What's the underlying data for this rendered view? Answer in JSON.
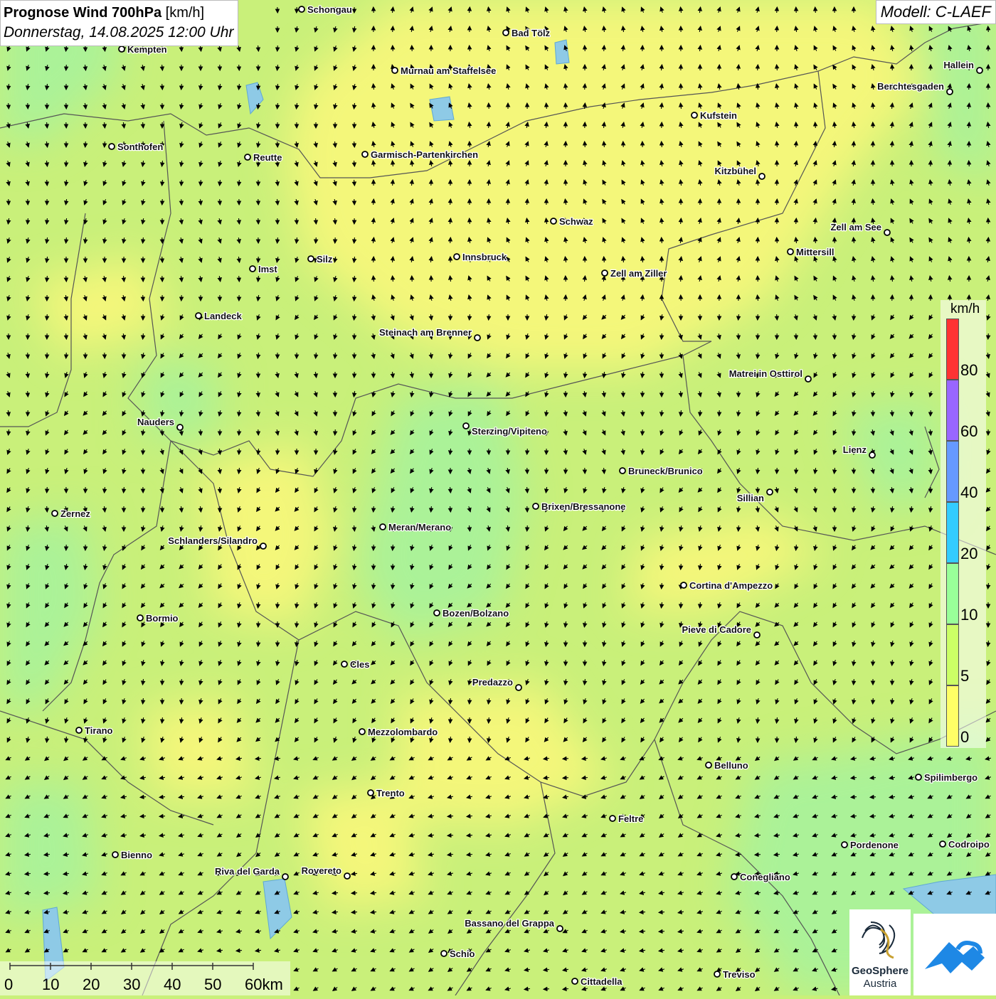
{
  "header": {
    "title_bold": "Prognose Wind 700hPa",
    "title_unit": " [km/h]",
    "datetime": "Donnerstag, 14.08.2025 12:00 Uhr"
  },
  "model": {
    "label": "Modell: C-LAEF"
  },
  "legend": {
    "unit": "km/h",
    "bins": [
      {
        "label": "0",
        "color": "#ffff66"
      },
      {
        "label": "5",
        "color": "#ccff66"
      },
      {
        "label": "10",
        "color": "#99ff99"
      },
      {
        "label": "20",
        "color": "#33ccff"
      },
      {
        "label": "40",
        "color": "#6699ff"
      },
      {
        "label": "60",
        "color": "#9966ff"
      },
      {
        "label": "80",
        "color": "#ff3333"
      }
    ]
  },
  "scalebar": {
    "labels": [
      "0",
      "10",
      "20",
      "30",
      "40",
      "50",
      "60km"
    ]
  },
  "logo": {
    "name_line1": "GeoSphere",
    "name_line2": "Austria"
  },
  "cities": [
    {
      "name": "Schongau",
      "anchor": "right"
    },
    {
      "name": "Bad Tölz",
      "anchor": "right"
    },
    {
      "name": "Kempten",
      "anchor": "right"
    },
    {
      "name": "Murnau am Staffelsee",
      "anchor": "right"
    },
    {
      "name": "Hallein",
      "anchor": "left"
    },
    {
      "name": "Berchtesgaden",
      "anchor": "left"
    },
    {
      "name": "Kufstein",
      "anchor": "right"
    },
    {
      "name": "Sonthofen",
      "anchor": "right"
    },
    {
      "name": "Reutte",
      "anchor": "right"
    },
    {
      "name": "Garmisch-Partenkirchen",
      "anchor": "right"
    },
    {
      "name": "Kitzbühel",
      "anchor": "left"
    },
    {
      "name": "Schwaz",
      "anchor": "right"
    },
    {
      "name": "Zell am See",
      "anchor": "left"
    },
    {
      "name": "Mittersill",
      "anchor": "right"
    },
    {
      "name": "Innsbruck",
      "anchor": "right"
    },
    {
      "name": "Silz",
      "anchor": "right"
    },
    {
      "name": "Imst",
      "anchor": "right"
    },
    {
      "name": "Zell am Ziller",
      "anchor": "right"
    },
    {
      "name": "Landeck",
      "anchor": "right"
    },
    {
      "name": "Steinach am Brenner",
      "anchor": "left"
    },
    {
      "name": "Matrei in Osttirol",
      "anchor": "left"
    },
    {
      "name": "Nauders",
      "anchor": "left"
    },
    {
      "name": "Sterzing/Vipiteno",
      "anchor": "right-below"
    },
    {
      "name": "Lienz",
      "anchor": "left"
    },
    {
      "name": "Bruneck/Brunico",
      "anchor": "right"
    },
    {
      "name": "Sillian",
      "anchor": "left-below"
    },
    {
      "name": "Zernez",
      "anchor": "right"
    },
    {
      "name": "Brixen/Bressanone",
      "anchor": "right"
    },
    {
      "name": "Meran/Merano",
      "anchor": "right"
    },
    {
      "name": "Schlanders/Silandro",
      "anchor": "left"
    },
    {
      "name": "Cortina d'Ampezzo",
      "anchor": "right"
    },
    {
      "name": "Bormio",
      "anchor": "right"
    },
    {
      "name": "Bozen/Bolzano",
      "anchor": "right"
    },
    {
      "name": "Pieve di Cadore",
      "anchor": "left"
    },
    {
      "name": "Cles",
      "anchor": "right"
    },
    {
      "name": "Predazzo",
      "anchor": "left"
    },
    {
      "name": "Tirano",
      "anchor": "right"
    },
    {
      "name": "Mezzolombardo",
      "anchor": "right"
    },
    {
      "name": "Belluno",
      "anchor": "right"
    },
    {
      "name": "Spilimbergo",
      "anchor": "right"
    },
    {
      "name": "Trento",
      "anchor": "right"
    },
    {
      "name": "Feltre",
      "anchor": "right"
    },
    {
      "name": "Pordenone",
      "anchor": "right"
    },
    {
      "name": "Codroipo",
      "anchor": "right"
    },
    {
      "name": "Bienno",
      "anchor": "right"
    },
    {
      "name": "Riva del Garda",
      "anchor": "left"
    },
    {
      "name": "Rovereto",
      "anchor": "left"
    },
    {
      "name": "Conegliano",
      "anchor": "right"
    },
    {
      "name": "Bassano del Grappa",
      "anchor": "left"
    },
    {
      "name": "Schio",
      "anchor": "right"
    },
    {
      "name": "Treviso",
      "anchor": "right"
    },
    {
      "name": "Cittadella",
      "anchor": "right"
    }
  ]
}
